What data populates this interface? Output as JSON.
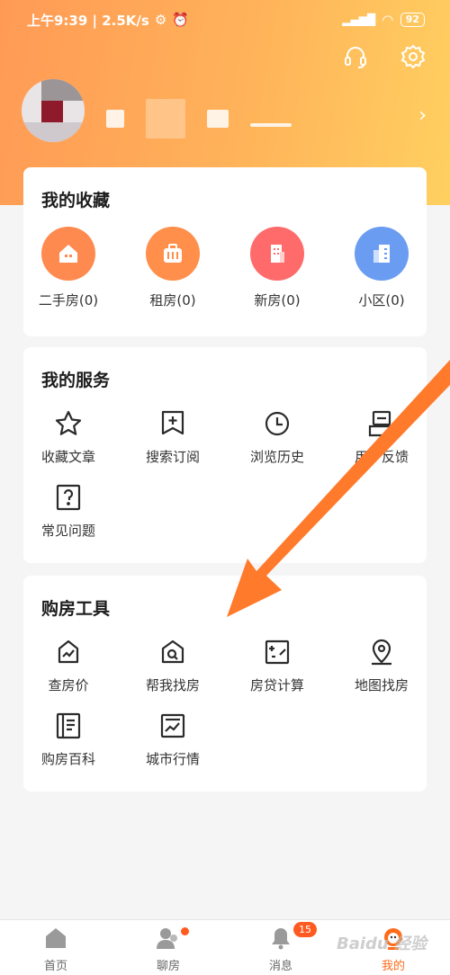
{
  "status_bar": {
    "time_speed": "上午9:39 | 2.5K/s",
    "signal": "4G",
    "battery": "92"
  },
  "header": {
    "icons": [
      "headset-icon",
      "gear-icon"
    ],
    "user_name": ""
  },
  "favorites": {
    "title": "我的收藏",
    "items": [
      {
        "label": "二手房(0)",
        "icon": "house-icon",
        "color": "#ff8a4f"
      },
      {
        "label": "租房(0)",
        "icon": "suitcase-icon",
        "color": "#ff8f4a"
      },
      {
        "label": "新房(0)",
        "icon": "building-icon",
        "color": "#ff6b6b"
      },
      {
        "label": "小区(0)",
        "icon": "community-icon",
        "color": "#6a9cf2"
      }
    ]
  },
  "services": {
    "title": "我的服务",
    "items": [
      {
        "label": "收藏文章",
        "icon": "star-icon"
      },
      {
        "label": "搜索订阅",
        "icon": "bookmark-plus-icon"
      },
      {
        "label": "浏览历史",
        "icon": "clock-icon"
      },
      {
        "label": "用户反馈",
        "icon": "feedback-icon"
      },
      {
        "label": "常见问题",
        "icon": "question-icon"
      }
    ]
  },
  "tools": {
    "title": "购房工具",
    "items": [
      {
        "label": "查房价",
        "icon": "price-trend-icon"
      },
      {
        "label": "帮我找房",
        "icon": "search-house-icon"
      },
      {
        "label": "房贷计算",
        "icon": "calculator-icon"
      },
      {
        "label": "地图找房",
        "icon": "map-pin-icon"
      },
      {
        "label": "购房百科",
        "icon": "book-icon"
      },
      {
        "label": "城市行情",
        "icon": "market-chart-icon"
      }
    ]
  },
  "tabbar": {
    "items": [
      {
        "label": "首页",
        "icon": "home-icon"
      },
      {
        "label": "聊房",
        "icon": "chat-users-icon"
      },
      {
        "label": "消息",
        "icon": "bell-icon",
        "badge": "15"
      },
      {
        "label": "我的",
        "icon": "mascot-icon"
      }
    ]
  },
  "watermark": "Baidu 经验",
  "colors": {
    "accent": "#ff6b1a",
    "arrow": "#ff7a2a"
  }
}
